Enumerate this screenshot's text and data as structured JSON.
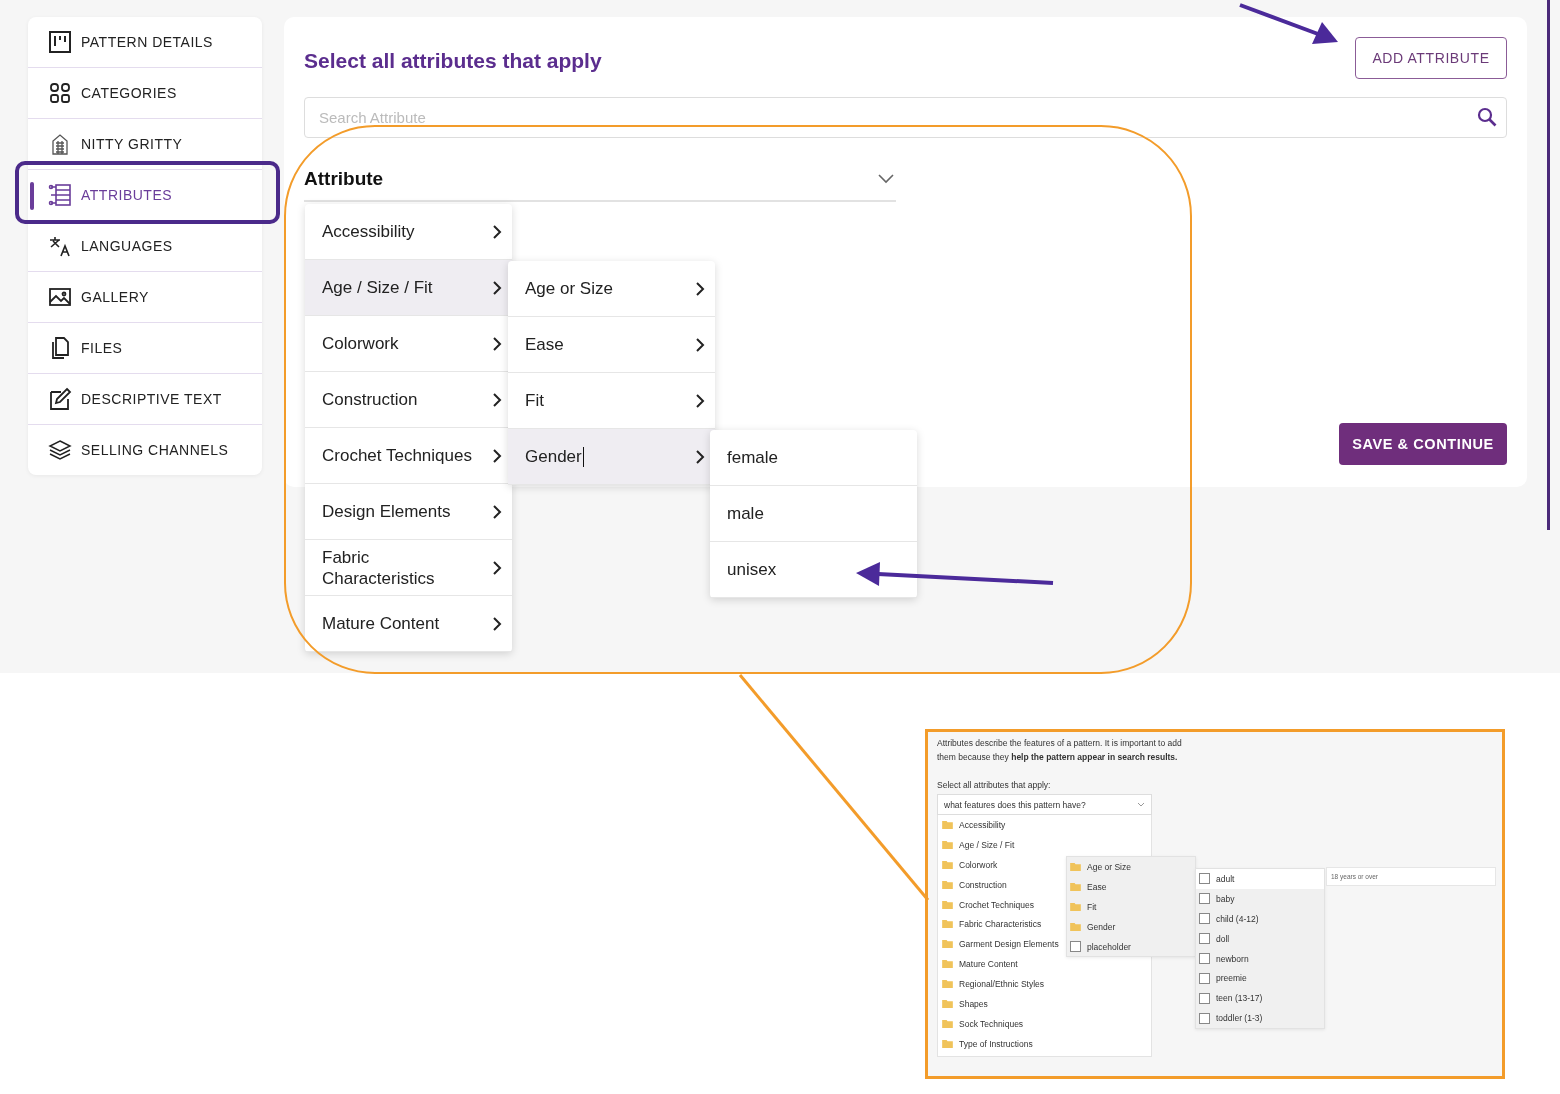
{
  "sidebar": {
    "items": [
      {
        "label": "PATTERN DETAILS",
        "kind": "pattern",
        "selected": false
      },
      {
        "label": "CATEGORIES",
        "kind": "grid",
        "selected": false
      },
      {
        "label": "NITTY GRITTY",
        "kind": "building",
        "selected": false
      },
      {
        "label": "ATTRIBUTES",
        "kind": "list",
        "selected": true
      },
      {
        "label": "LANGUAGES",
        "kind": "translate",
        "selected": false
      },
      {
        "label": "GALLERY",
        "kind": "image",
        "selected": false
      },
      {
        "label": "FILES",
        "kind": "files",
        "selected": false
      },
      {
        "label": "DESCRIPTIVE TEXT",
        "kind": "edit",
        "selected": false
      },
      {
        "label": "SELLING CHANNELS",
        "kind": "layers",
        "selected": false
      }
    ]
  },
  "main": {
    "title": "Select all attributes that apply",
    "add_button": "ADD ATTRIBUTE",
    "search": {
      "placeholder": "Search Attribute"
    },
    "dropdown": {
      "label": "Attribute"
    },
    "menus": [
      {
        "items": [
          {
            "label": "Accessibility",
            "selected": false
          },
          {
            "label": "Age / Size / Fit",
            "selected": true
          },
          {
            "label": "Colorwork",
            "selected": false
          },
          {
            "label": "Construction",
            "selected": false
          },
          {
            "label": "Crochet Techniques",
            "selected": false
          },
          {
            "label": "Design Elements",
            "selected": false
          },
          {
            "label": "Fabric Characteristics",
            "selected": false
          },
          {
            "label": "Mature Content",
            "selected": false
          }
        ]
      },
      {
        "items": [
          {
            "label": "Age or Size",
            "selected": false
          },
          {
            "label": "Ease",
            "selected": false
          },
          {
            "label": "Fit",
            "selected": false
          },
          {
            "label": "Gender",
            "selected": true
          }
        ]
      },
      {
        "items": [
          {
            "label": "female",
            "selected": false
          },
          {
            "label": "male",
            "selected": false
          },
          {
            "label": "unisex",
            "selected": false
          }
        ]
      }
    ],
    "save_button": "SAVE & CONTINUE"
  },
  "inset": {
    "intro": "Attributes describe the features of a pattern. It is important to add them because they **help the pattern appear in search results.**",
    "prompt": "Select all attributes that apply:",
    "select": {
      "placeholder": "what features does this pattern have?"
    },
    "categories": [
      "Accessibility",
      "Age / Size / Fit",
      "Colorwork",
      "Construction",
      "Crochet Techniques",
      "Fabric Characteristics",
      "Garment Design Elements",
      "Mature Content",
      "Regional/Ethnic Styles",
      "Shapes",
      "Sock Techniques",
      "Type of Instructions"
    ],
    "subcategories": [
      {
        "label": "Age or Size",
        "kind": "folder"
      },
      {
        "label": "Ease",
        "kind": "folder"
      },
      {
        "label": "Fit",
        "kind": "folder"
      },
      {
        "label": "Gender",
        "kind": "folder"
      },
      {
        "label": "placeholder",
        "kind": "checkbox",
        "checked": false
      }
    ],
    "options": [
      {
        "label": "adult",
        "checked": false,
        "selected": true
      },
      {
        "label": "baby",
        "checked": false,
        "selected": false
      },
      {
        "label": "child (4-12)",
        "checked": false,
        "selected": false
      },
      {
        "label": "doll",
        "checked": false,
        "selected": false
      },
      {
        "label": "newborn",
        "checked": false,
        "selected": false
      },
      {
        "label": "preemie",
        "checked": false,
        "selected": false
      },
      {
        "label": "teen (13-17)",
        "checked": false,
        "selected": false
      },
      {
        "label": "toddler (1-3)",
        "checked": false,
        "selected": false
      }
    ],
    "tooltip": "18 years or over"
  }
}
